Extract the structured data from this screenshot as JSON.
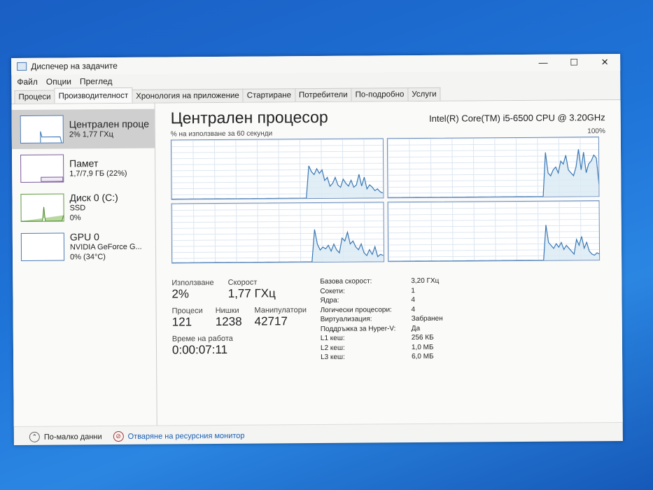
{
  "window": {
    "title": "Диспечер на задачите",
    "minimize": "—",
    "maximize": "☐",
    "close": "✕"
  },
  "menu": [
    "Файл",
    "Опции",
    "Преглед"
  ],
  "tabs": [
    "Процеси",
    "Производителност",
    "Хронология на приложение",
    "Стартиране",
    "Потребители",
    "По-подробно",
    "Услуги"
  ],
  "sidebar": [
    {
      "name": "Централен проце",
      "sub1": "2% 1,77 ГХц",
      "sub2": ""
    },
    {
      "name": "Памет",
      "sub1": "1,7/7,9 ГБ (22%)",
      "sub2": ""
    },
    {
      "name": "Диск 0 (C:)",
      "sub1": "SSD",
      "sub2": "0%"
    },
    {
      "name": "GPU 0",
      "sub1": "NVIDIA GeForce G...",
      "sub2": "0% (34°C)"
    }
  ],
  "main": {
    "title": "Централен процесор",
    "model": "Intel(R) Core(TM) i5-6500 CPU @ 3.20GHz",
    "graph_label": "% на използване за 60 секунди",
    "graph_max": "100%"
  },
  "cpu_usage": [
    [
      0,
      0,
      0,
      0,
      0,
      0,
      0,
      0,
      0,
      0,
      0,
      0,
      0,
      0,
      0,
      0,
      0,
      0,
      0,
      0,
      0,
      0,
      0,
      0,
      0,
      0,
      0,
      0,
      0,
      0,
      0,
      0,
      0,
      0,
      0,
      0,
      0,
      0,
      0,
      0,
      0,
      0,
      0,
      0,
      0,
      0,
      0,
      0,
      0,
      0,
      0,
      0,
      55,
      45,
      40,
      50,
      42,
      48,
      30,
      35,
      20,
      25,
      35,
      22,
      18,
      32,
      25,
      20,
      30,
      18,
      22,
      40,
      20,
      35,
      15,
      22,
      18,
      12,
      15,
      10,
      8
    ],
    [
      0,
      0,
      0,
      0,
      0,
      0,
      0,
      0,
      0,
      0,
      0,
      0,
      0,
      0,
      0,
      0,
      0,
      0,
      0,
      0,
      0,
      0,
      0,
      0,
      0,
      0,
      0,
      0,
      0,
      0,
      0,
      0,
      0,
      0,
      0,
      0,
      0,
      0,
      0,
      0,
      0,
      0,
      0,
      0,
      0,
      0,
      0,
      0,
      0,
      0,
      0,
      0,
      0,
      0,
      0,
      0,
      0,
      0,
      0,
      0,
      0,
      0,
      75,
      40,
      35,
      45,
      50,
      40,
      60,
      55,
      70,
      45,
      40,
      35,
      50,
      80,
      45,
      75,
      40,
      55,
      60,
      70,
      65,
      20
    ],
    [
      0,
      0,
      0,
      0,
      0,
      0,
      0,
      0,
      0,
      0,
      0,
      0,
      0,
      0,
      0,
      0,
      0,
      0,
      0,
      0,
      0,
      0,
      0,
      0,
      0,
      0,
      0,
      0,
      0,
      0,
      0,
      0,
      0,
      0,
      0,
      0,
      0,
      0,
      0,
      0,
      0,
      0,
      0,
      0,
      0,
      0,
      0,
      0,
      0,
      0,
      0,
      0,
      55,
      30,
      20,
      25,
      22,
      28,
      18,
      30,
      20,
      15,
      40,
      35,
      50,
      30,
      35,
      25,
      20,
      30,
      15,
      10,
      20,
      12,
      25,
      8,
      12,
      10
    ],
    [
      0,
      0,
      0,
      0,
      0,
      0,
      0,
      0,
      0,
      0,
      0,
      0,
      0,
      0,
      0,
      0,
      0,
      0,
      0,
      0,
      0,
      0,
      0,
      0,
      0,
      0,
      0,
      0,
      0,
      0,
      0,
      0,
      0,
      0,
      0,
      0,
      0,
      0,
      0,
      0,
      0,
      0,
      0,
      0,
      0,
      0,
      0,
      0,
      0,
      0,
      0,
      0,
      0,
      0,
      0,
      0,
      0,
      0,
      0,
      0,
      0,
      0,
      60,
      30,
      25,
      20,
      28,
      22,
      30,
      18,
      25,
      20,
      15,
      10,
      35,
      25,
      40,
      20,
      30,
      15,
      10,
      8,
      12,
      10
    ]
  ],
  "stats": {
    "usage_label": "Използване",
    "usage": "2%",
    "speed_label": "Скорост",
    "speed": "1,77 ГХц",
    "proc_label": "Процеси",
    "proc": "121",
    "threads_label": "Нишки",
    "threads": "1238",
    "handles_label": "Манипулатори",
    "handles": "42717",
    "uptime_label": "Време на работа",
    "uptime": "0:00:07:11"
  },
  "details": [
    [
      "Базова скорост:",
      "3,20 ГХц"
    ],
    [
      "Сокети:",
      "1"
    ],
    [
      "Ядра:",
      "4"
    ],
    [
      "Логически процесори:",
      "4"
    ],
    [
      "Виртуализация:",
      "Забранен"
    ],
    [
      "Поддръжка за Hyper-V:",
      "Да"
    ],
    [
      "L1 кеш:",
      "256 КБ"
    ],
    [
      "L2 кеш:",
      "1,0 МБ"
    ],
    [
      "L3 кеш:",
      "6,0 МБ"
    ]
  ],
  "footer": {
    "less": "По-малко данни",
    "monitor": "Отваряне на ресурсния монитор"
  }
}
